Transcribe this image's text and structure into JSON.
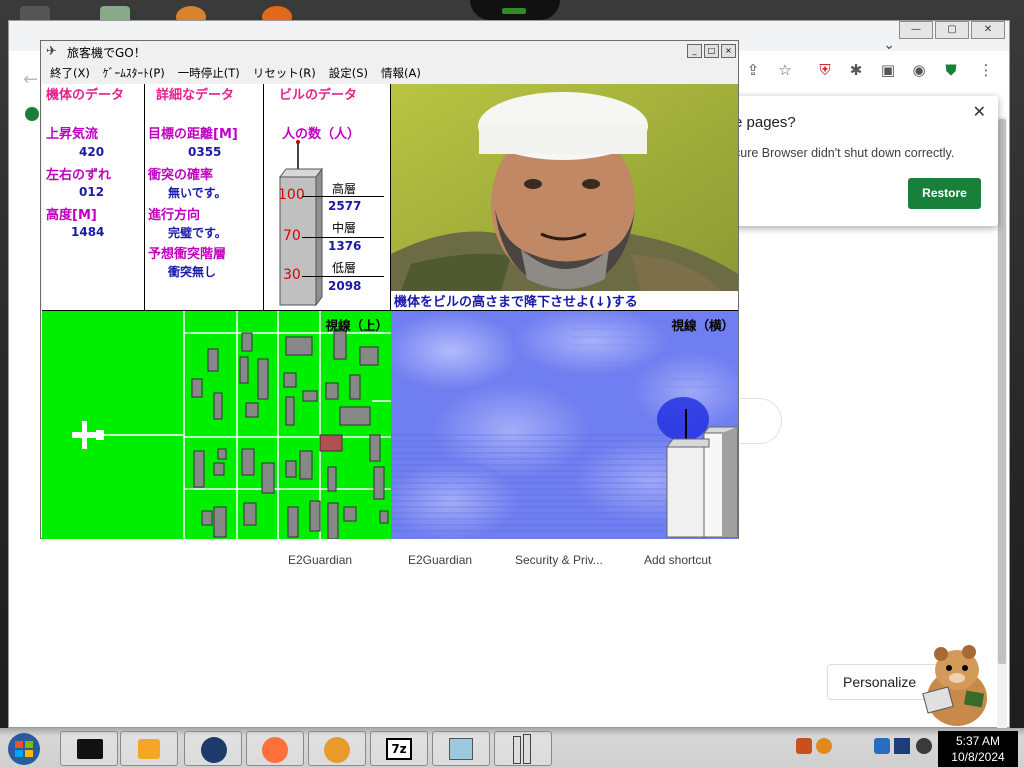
{
  "game_window": {
    "title": "旅客機でGO！",
    "menu": [
      "終了(X)",
      "ｹﾞｰﾑｽﾀｰﾄ(P)",
      "一時停止(T)",
      "リセット(R)",
      "設定(S)",
      "情報(A)"
    ]
  },
  "aircraft_data": {
    "heading": "機体のデータ",
    "updraft_label": "上昇気流",
    "updraft_value": "420",
    "drift_label": "左右のずれ",
    "drift_value": "012",
    "altitude_label": "高度[M]",
    "altitude_value": "1484"
  },
  "detail_data": {
    "heading": "詳細なデータ",
    "distance_label": "目標の距離[M]",
    "distance_value": "0355",
    "collision_label": "衝突の確率",
    "collision_value": "無いです。",
    "direction_label": "進行方向",
    "direction_value": "完璧です。",
    "floor_label": "予想衝突階層",
    "floor_value": "衝突無し"
  },
  "building_data": {
    "heading": "ビルのデータ",
    "people_label": "人の数（人）",
    "level_high_label": "100",
    "level_mid_label": "70",
    "level_low_label": "30",
    "high_label": "高層",
    "high_value": "2577",
    "mid_label": "中層",
    "mid_value": "1376",
    "low_label": "低層",
    "low_value": "2098"
  },
  "instruction": "機体をビルの高さまで降下させよ(↓)する",
  "view_top_label": "視線（上）",
  "view_side_label": "視線（横）",
  "browser": {
    "restore_title": "e pages?",
    "restore_message": "cure Browser didn't shut down correctly.",
    "restore_button": "Restore",
    "shortcuts": [
      "E2Guardian",
      "E2Guardian",
      "Security & Priv...",
      "Add shortcut"
    ],
    "personalize": "Personalize"
  },
  "taskbar": {
    "time": "5:37 AM",
    "date": "10/8/2024"
  },
  "colors": {
    "heading_pink": "#e8208c",
    "label_magenta": "#c000c0",
    "value_blue": "#1a1aaa",
    "radar_green": "#00ee00",
    "restore_green": "#188038"
  }
}
